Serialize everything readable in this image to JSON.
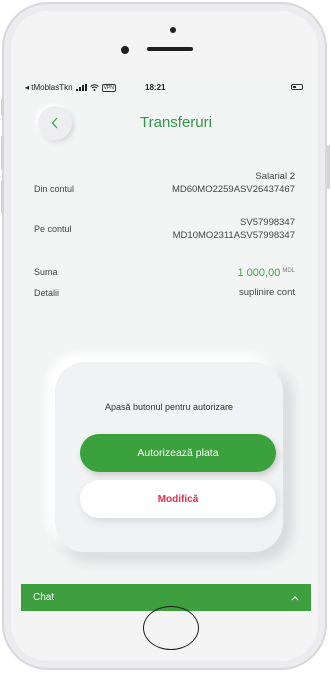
{
  "status_bar": {
    "carrier": "◂ tMoblasTkn",
    "vpn_badge": "VPN",
    "time": "18:21"
  },
  "header": {
    "back_icon": "chevron-left-icon",
    "title": "Transferuri"
  },
  "transfer": {
    "from_label": "Din contul",
    "from_name": "Salarial 2",
    "from_iban": "MD60MO2259ASV26437467",
    "to_label": "Pe contul",
    "to_account": "SV57998347",
    "to_iban": "MD10MO2311ASV57998347",
    "amount_label": "Suma",
    "amount_value": "1 000,00",
    "amount_currency": "MDL",
    "details_label": "Detalii",
    "details_value": "suplinire cont"
  },
  "auth_card": {
    "hint": "Apasă butonul pentru autorizare",
    "authorize_label": "Autorizează plata",
    "modify_label": "Modifică"
  },
  "chat": {
    "label": "Chat",
    "toggle_icon": "chevron-up-icon"
  },
  "colors": {
    "accent_green": "#3aa13d",
    "modify_red": "#e0304a"
  }
}
